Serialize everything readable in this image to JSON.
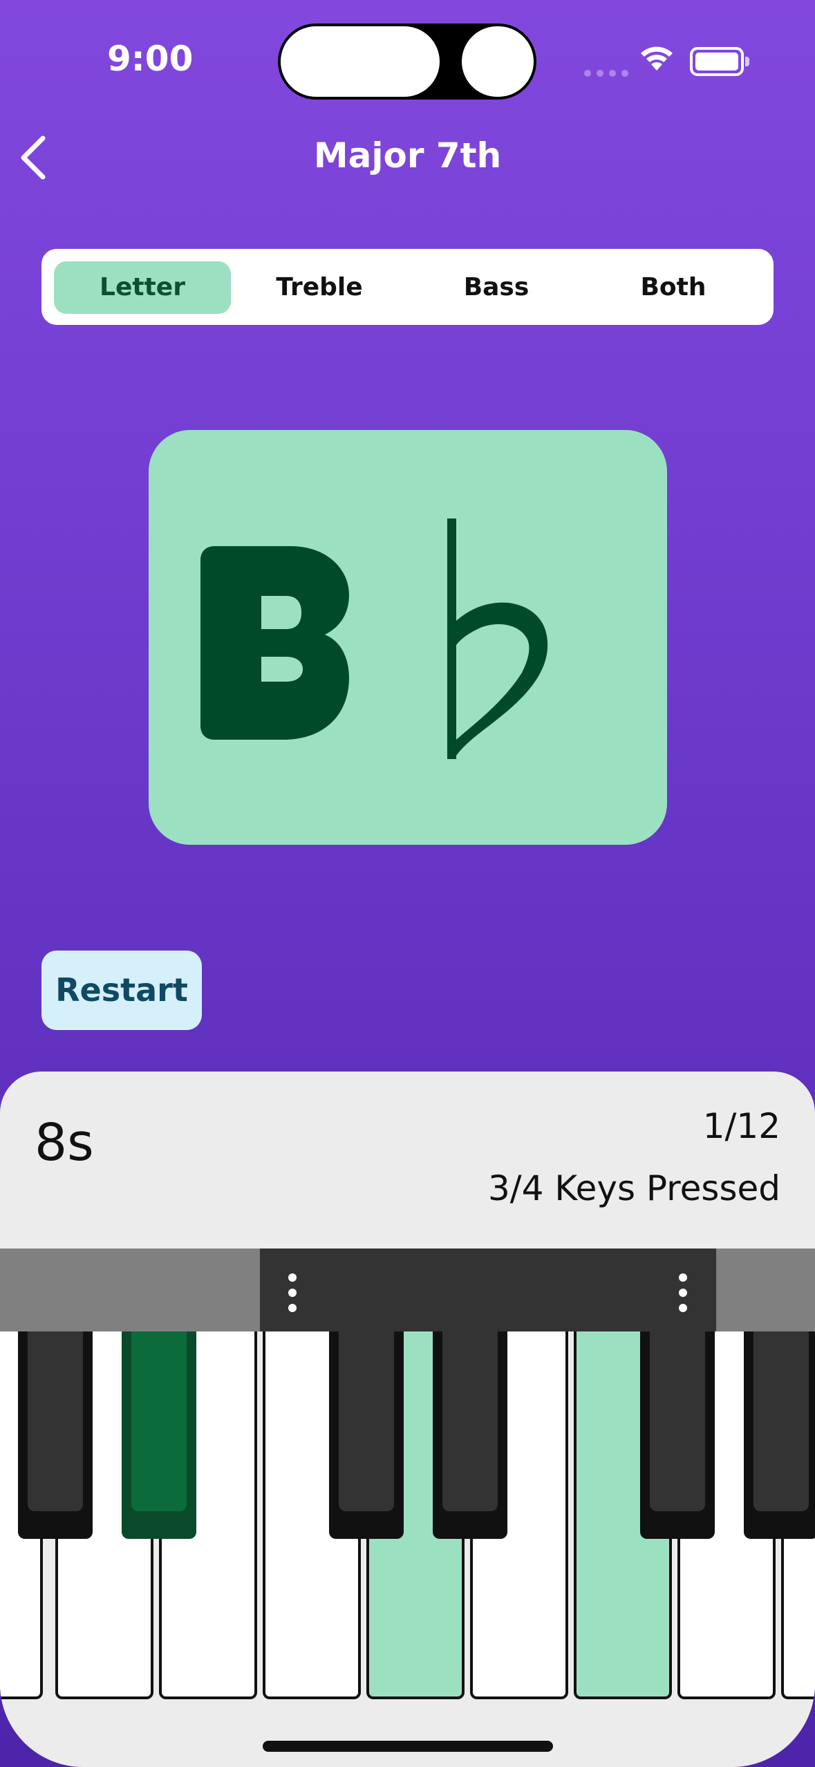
{
  "status": {
    "time": "9:00"
  },
  "nav": {
    "title": "Major 7th",
    "back_icon": "chevron-left-icon"
  },
  "tabs": [
    {
      "label": "Letter",
      "active": true
    },
    {
      "label": "Treble",
      "active": false
    },
    {
      "label": "Bass",
      "active": false
    },
    {
      "label": "Both",
      "active": false
    }
  ],
  "card": {
    "note_letter": "B",
    "accidental": "♭"
  },
  "restart_label": "Restart",
  "stats": {
    "time": "8s",
    "progress": "1/12",
    "keys_pressed": "3/4 Keys Pressed"
  },
  "colors": {
    "accent_green": "#9CE0C2",
    "dark_green": "#004A2A",
    "restart_bg": "#D5F0FB",
    "purple": "#7A40D6"
  },
  "keyboard": {
    "highlighted_white": [
      4,
      6
    ],
    "highlighted_black": [
      1
    ]
  }
}
